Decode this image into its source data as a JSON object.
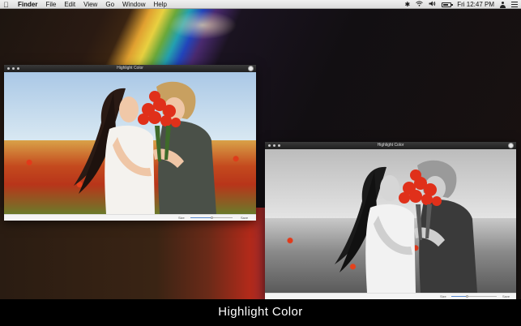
{
  "menubar": {
    "apple_icon": "apple-logo",
    "app_name": "Finder",
    "menus": [
      "File",
      "Edit",
      "View",
      "Go",
      "Window",
      "Help"
    ],
    "status": {
      "bluetooth_icon": "bluetooth-icon",
      "wifi_icon": "wifi-icon",
      "volume_icon": "volume-icon",
      "battery_icon": "battery-icon",
      "clock": "Fri 12:47 PM",
      "user_icon": "user-icon",
      "list_icon": "notification-list-icon"
    }
  },
  "window_left": {
    "title": "Highlight Color",
    "size_label": "Size",
    "save_label": "Save",
    "slider_value": 0.5
  },
  "window_right": {
    "title": "Highlight Color",
    "size_label": "Size",
    "save_label": "Save",
    "slider_value": 0.35
  },
  "caption": "Highlight Color",
  "colors": {
    "menubar": "#e6e6e6",
    "titlebar": "#2a2a2a",
    "highlight_red": "#e0301a"
  }
}
